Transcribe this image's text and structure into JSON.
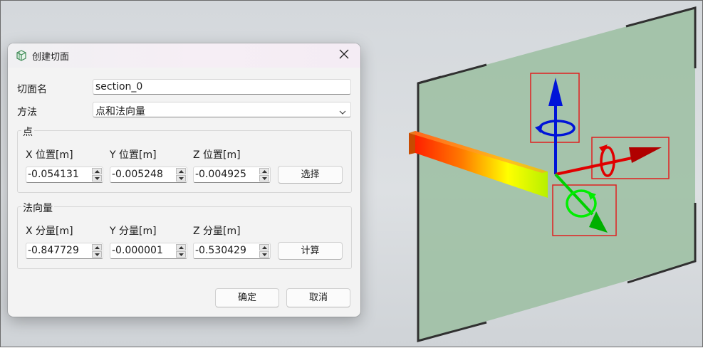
{
  "dialog": {
    "title": "创建切面",
    "name_label": "切面名",
    "name_value": "section_0",
    "method_label": "方法",
    "method_value": "点和法向量",
    "point_group": {
      "title": "点",
      "x_label": "X 位置[m]",
      "y_label": "Y 位置[m]",
      "z_label": "Z 位置[m]",
      "x_value": "-0.054131",
      "y_value": "-0.005248",
      "z_value": "-0.004925",
      "select_label": "选择"
    },
    "normal_group": {
      "title": "法向量",
      "x_label": "X 分量[m]",
      "y_label": "Y 分量[m]",
      "z_label": "Z 分量[m]",
      "x_value": "-0.847729",
      "y_value": "-0.000001",
      "z_value": "-0.530429",
      "compute_label": "计算"
    },
    "ok_label": "确定",
    "cancel_label": "取消"
  },
  "viewport": {
    "background": "#d8dbdf",
    "plane_color": "#9dbfa3",
    "axis_colors": {
      "y": "#0014d8",
      "x": "#e00000",
      "z": "#00d000"
    },
    "gizmo_box_color": "#e02020",
    "icons": [
      "close-icon",
      "section-cube-icon",
      "chevron-down-icon"
    ]
  }
}
